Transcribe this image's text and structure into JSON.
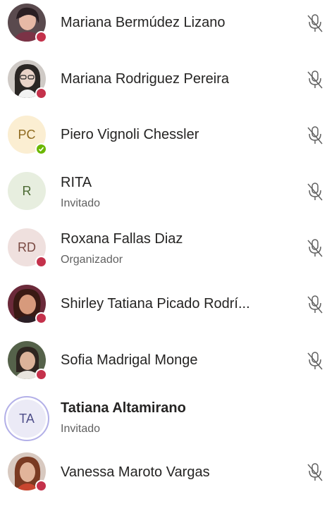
{
  "colors": {
    "busy": "#c4314b",
    "available": "#6bb700",
    "initials_pc_bg": "#fbeed2",
    "initials_pc_fg": "#8f6a1f",
    "initials_r_bg": "#e7eedf",
    "initials_r_fg": "#4b6a33",
    "initials_rd_bg": "#efe0de",
    "initials_rd_fg": "#7a4a43",
    "initials_ta_bg": "#ebeaf6",
    "initials_ta_fg": "#4f4f8a",
    "initials_ta_ring": "#b3b0e8"
  },
  "participants": [
    {
      "name": "Mariana Bermúdez Lizano",
      "role": "",
      "avatar": "photo",
      "presence": "busy",
      "icon": "mic-off-icon"
    },
    {
      "name": "Mariana Rodriguez Pereira",
      "role": "",
      "avatar": "photo",
      "presence": "busy",
      "icon": "mic-off-icon"
    },
    {
      "name": "Piero Vignoli Chessler",
      "role": "",
      "avatar": "initials",
      "initials": "PC",
      "presence": "available",
      "icon": "mic-off-icon"
    },
    {
      "name": "RITA",
      "role": "Invitado",
      "avatar": "initials",
      "initials": "R",
      "presence": "none",
      "icon": "mic-off-icon"
    },
    {
      "name": "Roxana Fallas Diaz",
      "role": "Organizador",
      "avatar": "initials",
      "initials": "RD",
      "presence": "busy",
      "icon": "mic-off-icon"
    },
    {
      "name": "Shirley Tatiana Picado Rodrí...",
      "role": "",
      "avatar": "photo",
      "presence": "busy",
      "icon": "mic-off-icon"
    },
    {
      "name": "Sofia Madrigal Monge",
      "role": "",
      "avatar": "photo",
      "presence": "busy",
      "icon": "mic-off-icon"
    },
    {
      "name": "Tatiana Altamirano",
      "role": "Invitado",
      "avatar": "initials",
      "initials": "TA",
      "presence": "none",
      "icon": ""
    },
    {
      "name": "Vanessa Maroto Vargas",
      "role": "",
      "avatar": "photo",
      "presence": "busy",
      "icon": "mic-off-icon"
    }
  ]
}
